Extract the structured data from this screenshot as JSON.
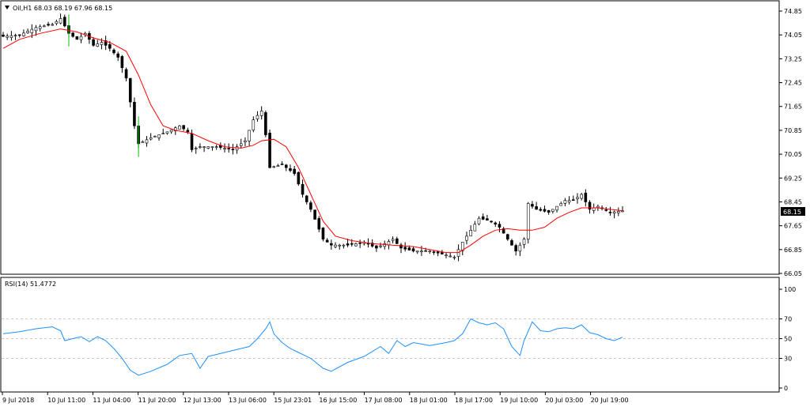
{
  "header": {
    "symbol_line": "Oil,H1  68.03 68.19 67.96 68.15",
    "collapse_icon": "triangle-down-icon"
  },
  "rsi": {
    "label": "RSI(14) 51.4772",
    "levels": [
      70,
      50,
      30
    ],
    "scale_labels": [
      "100",
      "70",
      "50",
      "30",
      "0"
    ]
  },
  "price_axis": {
    "ticks": [
      "74.85",
      "74.05",
      "73.25",
      "72.45",
      "71.65",
      "70.85",
      "70.05",
      "69.25",
      "68.45",
      "67.65",
      "66.85",
      "66.05"
    ],
    "current_price": "68.15"
  },
  "time_axis": {
    "labels": [
      "9 Jul 2018",
      "10 Jul 11:00",
      "11 Jul 04:00",
      "11 Jul 20:00",
      "12 Jul 13:00",
      "13 Jul 06:00",
      "15 Jul 23:01",
      "16 Jul 15:00",
      "17 Jul 08:00",
      "18 Jul 01:00",
      "18 Jul 17:00",
      "19 Jul 10:00",
      "20 Jul 03:00",
      "20 Jul 19:00"
    ]
  },
  "colors": {
    "bull": "#00c000",
    "bear": "#8b0000",
    "ma": "#ff0000",
    "rsi": "#1e90ff",
    "grid": "#c8c8c8",
    "frame": "#000000"
  },
  "chart_data": [
    {
      "type": "candlestick",
      "symbol": "Oil",
      "timeframe": "H1",
      "ylim": [
        66.05,
        74.85
      ],
      "close_path": [
        [
          0,
          74.0
        ],
        [
          4,
          74.05
        ],
        [
          8,
          74.3
        ],
        [
          12,
          74.4
        ],
        [
          14,
          74.6
        ],
        [
          16,
          74.1
        ],
        [
          18,
          73.9
        ],
        [
          20,
          74.1
        ],
        [
          22,
          73.7
        ],
        [
          24,
          73.8
        ],
        [
          26,
          73.6
        ],
        [
          28,
          73.3
        ],
        [
          30,
          72.6
        ],
        [
          32,
          71.0
        ],
        [
          33,
          70.4
        ],
        [
          36,
          70.6
        ],
        [
          40,
          70.8
        ],
        [
          43,
          71.0
        ],
        [
          45,
          70.8
        ],
        [
          46,
          70.2
        ],
        [
          48,
          70.3
        ],
        [
          52,
          70.3
        ],
        [
          56,
          70.2
        ],
        [
          59,
          70.5
        ],
        [
          61,
          71.2
        ],
        [
          63,
          71.5
        ],
        [
          64,
          70.7
        ],
        [
          65,
          69.6
        ],
        [
          68,
          69.7
        ],
        [
          71,
          69.4
        ],
        [
          73,
          68.7
        ],
        [
          75,
          68.2
        ],
        [
          78,
          67.2
        ],
        [
          80,
          67.0
        ],
        [
          84,
          67.0
        ],
        [
          88,
          67.1
        ],
        [
          91,
          66.9
        ],
        [
          95,
          67.2
        ],
        [
          97,
          66.9
        ],
        [
          100,
          66.8
        ],
        [
          104,
          66.8
        ],
        [
          107,
          66.7
        ],
        [
          110,
          66.6
        ],
        [
          112,
          67.1
        ],
        [
          114,
          67.5
        ],
        [
          116,
          67.9
        ],
        [
          119,
          67.8
        ],
        [
          121,
          67.6
        ],
        [
          123,
          67.2
        ],
        [
          125,
          66.8
        ],
        [
          127,
          67.2
        ],
        [
          128,
          68.4
        ],
        [
          130,
          68.2
        ],
        [
          133,
          68.1
        ],
        [
          135,
          68.3
        ],
        [
          137,
          68.5
        ],
        [
          139,
          68.5
        ],
        [
          141,
          68.7
        ],
        [
          143,
          68.2
        ],
        [
          145,
          68.3
        ],
        [
          148,
          68.1
        ],
        [
          151,
          68.15
        ]
      ],
      "moving_average": [
        [
          0,
          73.6
        ],
        [
          4,
          73.9
        ],
        [
          9,
          74.1
        ],
        [
          14,
          74.25
        ],
        [
          18,
          74.15
        ],
        [
          22,
          73.95
        ],
        [
          26,
          73.8
        ],
        [
          30,
          73.5
        ],
        [
          33,
          72.7
        ],
        [
          36,
          71.7
        ],
        [
          39,
          71.0
        ],
        [
          42,
          70.85
        ],
        [
          46,
          70.75
        ],
        [
          50,
          70.5
        ],
        [
          54,
          70.3
        ],
        [
          58,
          70.25
        ],
        [
          61,
          70.35
        ],
        [
          63,
          70.5
        ],
        [
          66,
          70.55
        ],
        [
          69,
          70.3
        ],
        [
          72,
          69.6
        ],
        [
          75,
          68.7
        ],
        [
          78,
          67.8
        ],
        [
          81,
          67.3
        ],
        [
          85,
          67.15
        ],
        [
          90,
          67.05
        ],
        [
          95,
          67.0
        ],
        [
          100,
          66.95
        ],
        [
          104,
          66.85
        ],
        [
          108,
          66.75
        ],
        [
          111,
          66.75
        ],
        [
          114,
          67.0
        ],
        [
          117,
          67.3
        ],
        [
          120,
          67.5
        ],
        [
          123,
          67.55
        ],
        [
          126,
          67.5
        ],
        [
          129,
          67.5
        ],
        [
          132,
          67.6
        ],
        [
          135,
          67.9
        ],
        [
          138,
          68.1
        ],
        [
          141,
          68.25
        ],
        [
          145,
          68.25
        ],
        [
          151,
          68.15
        ]
      ]
    },
    {
      "type": "line",
      "name": "RSI(14)",
      "ylim": [
        0,
        100
      ],
      "points": [
        [
          0,
          55
        ],
        [
          4,
          57
        ],
        [
          8,
          60
        ],
        [
          12,
          62
        ],
        [
          14,
          58
        ],
        [
          15,
          48
        ],
        [
          17,
          50
        ],
        [
          19,
          52
        ],
        [
          21,
          47
        ],
        [
          23,
          52
        ],
        [
          25,
          48
        ],
        [
          27,
          40
        ],
        [
          29,
          30
        ],
        [
          31,
          18
        ],
        [
          33,
          13
        ],
        [
          36,
          17
        ],
        [
          40,
          24
        ],
        [
          43,
          33
        ],
        [
          46,
          35
        ],
        [
          48,
          20
        ],
        [
          50,
          32
        ],
        [
          52,
          34
        ],
        [
          56,
          38
        ],
        [
          60,
          42
        ],
        [
          62,
          50
        ],
        [
          64,
          60
        ],
        [
          65,
          67
        ],
        [
          66,
          55
        ],
        [
          68,
          46
        ],
        [
          70,
          40
        ],
        [
          72,
          36
        ],
        [
          75,
          30
        ],
        [
          78,
          20
        ],
        [
          80,
          17
        ],
        [
          84,
          26
        ],
        [
          88,
          32
        ],
        [
          92,
          42
        ],
        [
          94,
          35
        ],
        [
          96,
          48
        ],
        [
          98,
          42
        ],
        [
          100,
          46
        ],
        [
          104,
          43
        ],
        [
          108,
          46
        ],
        [
          110,
          48
        ],
        [
          112,
          55
        ],
        [
          114,
          70
        ],
        [
          116,
          66
        ],
        [
          118,
          64
        ],
        [
          120,
          66
        ],
        [
          122,
          60
        ],
        [
          124,
          42
        ],
        [
          126,
          33
        ],
        [
          127,
          48
        ],
        [
          129,
          67
        ],
        [
          131,
          58
        ],
        [
          133,
          57
        ],
        [
          135,
          60
        ],
        [
          137,
          61
        ],
        [
          139,
          60
        ],
        [
          141,
          64
        ],
        [
          143,
          56
        ],
        [
          145,
          54
        ],
        [
          147,
          50
        ],
        [
          149,
          48
        ],
        [
          151,
          51.4772
        ]
      ]
    }
  ]
}
